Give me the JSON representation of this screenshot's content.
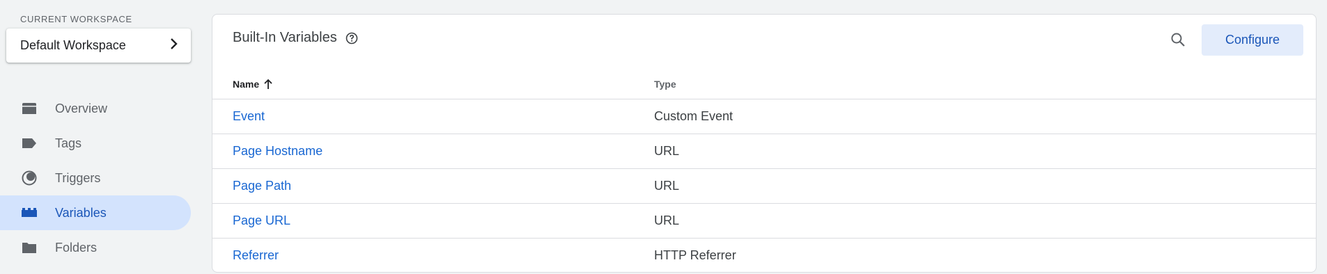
{
  "workspace": {
    "label": "CURRENT WORKSPACE",
    "name": "Default Workspace"
  },
  "nav": {
    "items": [
      {
        "label": "Overview",
        "icon": "overview-icon"
      },
      {
        "label": "Tags",
        "icon": "tag-icon"
      },
      {
        "label": "Triggers",
        "icon": "trigger-icon"
      },
      {
        "label": "Variables",
        "icon": "variables-icon",
        "active": true
      },
      {
        "label": "Folders",
        "icon": "folder-icon"
      }
    ]
  },
  "panel": {
    "title": "Built-In Variables",
    "configure_label": "Configure",
    "columns": {
      "name": "Name",
      "type": "Type"
    },
    "rows": [
      {
        "name": "Event",
        "type": "Custom Event"
      },
      {
        "name": "Page Hostname",
        "type": "URL"
      },
      {
        "name": "Page Path",
        "type": "URL"
      },
      {
        "name": "Page URL",
        "type": "URL"
      },
      {
        "name": "Referrer",
        "type": "HTTP Referrer"
      }
    ]
  },
  "colors": {
    "accent": "#1967d2",
    "active_nav_bg": "#d3e3fd",
    "configure_bg": "#e3ecfb"
  }
}
